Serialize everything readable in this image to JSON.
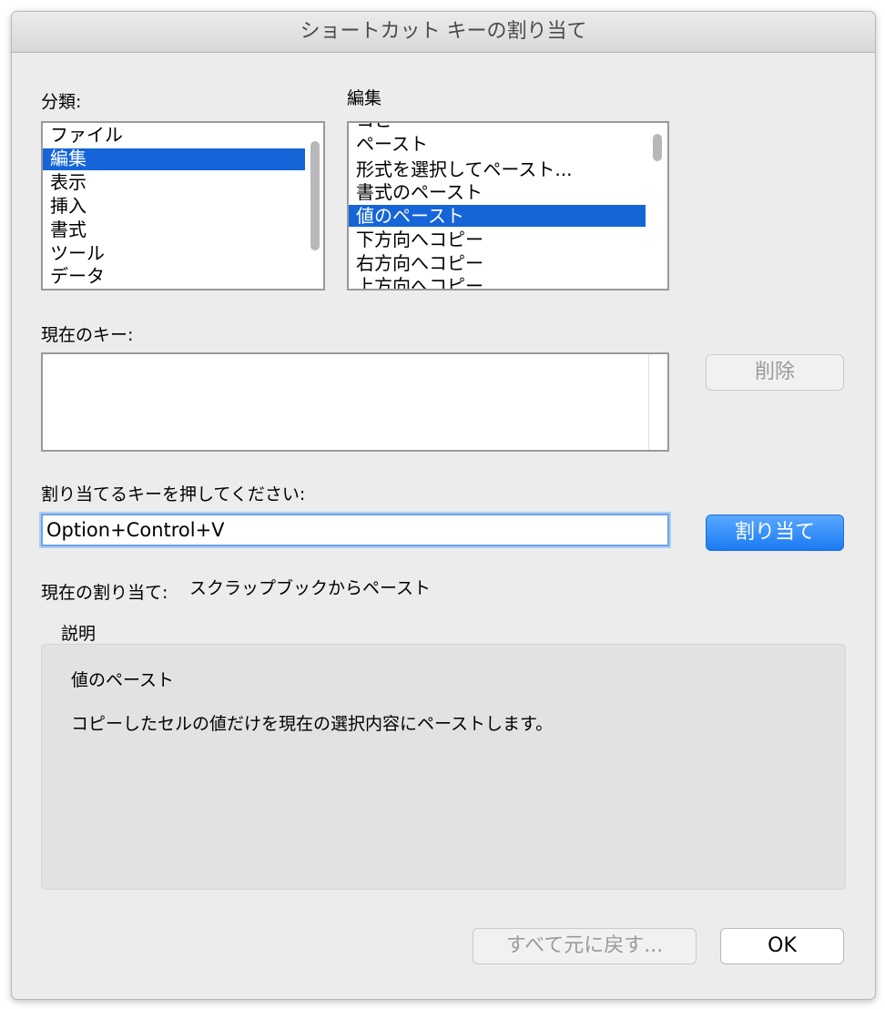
{
  "dialog": {
    "title": "ショートカット キーの割り当て"
  },
  "categories": {
    "label": "分類:",
    "items": [
      "ファイル",
      "編集",
      "表示",
      "挿入",
      "書式",
      "ツール",
      "データ"
    ],
    "selected": "編集"
  },
  "commands": {
    "label": "編集",
    "items": [
      "コピー",
      "ペースト",
      "形式を選択してペースト...",
      "書式のペースト",
      "値のペースト",
      "下方向へコピー",
      "右方向へコピー",
      "上方向へコピー"
    ],
    "selected": "値のペースト"
  },
  "current_keys": {
    "label": "現在のキー:",
    "remove_button": "削除"
  },
  "new_key": {
    "label": "割り当てるキーを押してください:",
    "value": "Option+Control+V",
    "assign_button": "割り当て"
  },
  "current_assignment": {
    "label": "現在の割り当て:",
    "value": "スクラップブックからペースト"
  },
  "description": {
    "label": "説明",
    "title": "値のペースト",
    "text": "コピーしたセルの値だけを現在の選択内容にペーストします。"
  },
  "footer": {
    "reset_button": "すべて元に戻す...",
    "ok_button": "OK"
  },
  "colors": {
    "selection": "#1565d8",
    "primary_button": "#1a7bf2",
    "focus_ring": "#6aa3e8"
  }
}
